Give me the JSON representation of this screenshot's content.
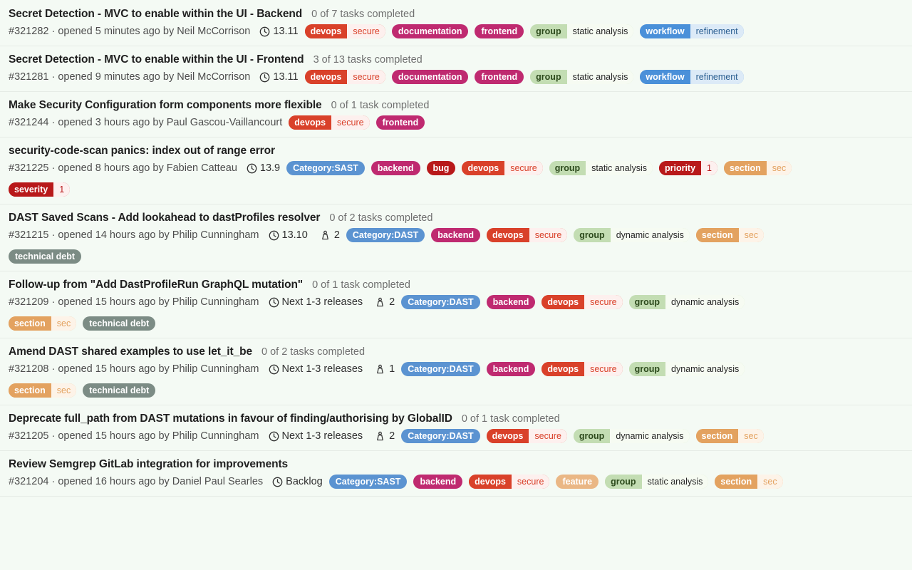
{
  "view": {
    "background_color": "#f4faf4",
    "separator_color": "#e6ece6",
    "icons": {
      "milestone": "clock-icon",
      "weight": "weight-icon"
    }
  },
  "label_styles": {
    "Category:SAST": {
      "type": "single",
      "bg": "#5b93d1",
      "fg": "#ffffff"
    },
    "Category:DAST": {
      "type": "single",
      "bg": "#5b93d1",
      "fg": "#ffffff"
    },
    "backend": {
      "type": "single",
      "bg": "#c02croak",
      "fg": "#ffffff"
    },
    "bug": {
      "type": "single",
      "bg": "#b8191a",
      "fg": "#ffffff"
    },
    "frontend": {
      "type": "single",
      "bg": "#bf2a70",
      "fg": "#ffffff"
    },
    "documentation": {
      "type": "single",
      "bg": "#bf2a70",
      "fg": "#ffffff"
    },
    "feature": {
      "type": "single",
      "bg": "#eab785",
      "fg": "#ffffff"
    },
    "technical debt": {
      "type": "single",
      "bg": "#7c8c85",
      "fg": "#ffffff"
    }
  },
  "issues": [
    {
      "title": "Secret Detection - MVC to enable within the UI - Backend",
      "task_status": "0 of 7 tasks completed",
      "reference": "#321282",
      "separator": "·",
      "opened": "opened 5 minutes ago by",
      "author": "Neil McCorrison",
      "milestone": "13.11",
      "weight": null,
      "labels": [
        {
          "key": "devops",
          "val": "secure",
          "key_bg": "#d9412a",
          "key_fg": "#ffffff",
          "val_bg": "#fdf0ee",
          "val_fg": "#d9412a"
        },
        {
          "key": "documentation",
          "val": null,
          "key_bg": "#bf2a70",
          "key_fg": "#ffffff"
        },
        {
          "key": "frontend",
          "val": null,
          "key_bg": "#bf2a70",
          "key_fg": "#ffffff"
        },
        {
          "key": "group",
          "val": "static analysis",
          "key_bg": "#c3ddb3",
          "key_fg": "#2c4a1c",
          "val_bg": "#f6fbf2",
          "val_fg": "#262626"
        },
        {
          "key": "workflow",
          "val": "refinement",
          "key_bg": "#4a90d9",
          "key_fg": "#ffffff",
          "val_bg": "#dceaf7",
          "val_fg": "#2b5f91"
        }
      ]
    },
    {
      "title": "Secret Detection - MVC to enable within the UI - Frontend",
      "task_status": "3 of 13 tasks completed",
      "reference": "#321281",
      "separator": "·",
      "opened": "opened 9 minutes ago by",
      "author": "Neil McCorrison",
      "milestone": "13.11",
      "weight": null,
      "labels": [
        {
          "key": "devops",
          "val": "secure",
          "key_bg": "#d9412a",
          "key_fg": "#ffffff",
          "val_bg": "#fdf0ee",
          "val_fg": "#d9412a"
        },
        {
          "key": "documentation",
          "val": null,
          "key_bg": "#bf2a70",
          "key_fg": "#ffffff"
        },
        {
          "key": "frontend",
          "val": null,
          "key_bg": "#bf2a70",
          "key_fg": "#ffffff"
        },
        {
          "key": "group",
          "val": "static analysis",
          "key_bg": "#c3ddb3",
          "key_fg": "#2c4a1c",
          "val_bg": "#f6fbf2",
          "val_fg": "#262626"
        },
        {
          "key": "workflow",
          "val": "refinement",
          "key_bg": "#4a90d9",
          "key_fg": "#ffffff",
          "val_bg": "#dceaf7",
          "val_fg": "#2b5f91"
        }
      ]
    },
    {
      "title": "Make Security Configuration form components more flexible",
      "task_status": "0 of 1 task completed",
      "reference": "#321244",
      "separator": "·",
      "opened": "opened 3 hours ago by",
      "author": "Paul Gascou-Vaillancourt",
      "milestone": null,
      "weight": null,
      "labels": [
        {
          "key": "devops",
          "val": "secure",
          "key_bg": "#d9412a",
          "key_fg": "#ffffff",
          "val_bg": "#fdf0ee",
          "val_fg": "#d9412a"
        },
        {
          "key": "frontend",
          "val": null,
          "key_bg": "#bf2a70",
          "key_fg": "#ffffff"
        }
      ]
    },
    {
      "title": "security-code-scan panics: index out of range error",
      "task_status": null,
      "reference": "#321225",
      "separator": "·",
      "opened": "opened 8 hours ago by",
      "author": "Fabien Catteau",
      "milestone": "13.9",
      "weight": null,
      "labels": [
        {
          "key": "Category:SAST",
          "val": null,
          "key_bg": "#5b93d1",
          "key_fg": "#ffffff"
        },
        {
          "key": "backend",
          "val": null,
          "key_bg": "#bf2a70",
          "key_fg": "#ffffff"
        },
        {
          "key": "bug",
          "val": null,
          "key_bg": "#b8191a",
          "key_fg": "#ffffff"
        },
        {
          "key": "devops",
          "val": "secure",
          "key_bg": "#d9412a",
          "key_fg": "#ffffff",
          "val_bg": "#fdf0ee",
          "val_fg": "#d9412a"
        },
        {
          "key": "group",
          "val": "static analysis",
          "key_bg": "#c3ddb3",
          "key_fg": "#2c4a1c",
          "val_bg": "#f6fbf2",
          "val_fg": "#262626"
        },
        {
          "key": "priority",
          "val": "1",
          "key_bg": "#b8191a",
          "key_fg": "#ffffff",
          "val_bg": "#fdf0ef",
          "val_fg": "#b8191a"
        },
        {
          "key": "section",
          "val": "sec",
          "key_bg": "#e3a260",
          "key_fg": "#ffffff",
          "val_bg": "#fdf3e8",
          "val_fg": "#e3a260"
        },
        {
          "key": "severity",
          "val": "1",
          "key_bg": "#b8191a",
          "key_fg": "#ffffff",
          "val_bg": "#fdf0ef",
          "val_fg": "#b8191a",
          "wrap_before": true
        }
      ]
    },
    {
      "title": "DAST Saved Scans - Add lookahead to dastProfiles resolver",
      "task_status": "0 of 2 tasks completed",
      "reference": "#321215",
      "separator": "·",
      "opened": "opened 14 hours ago by",
      "author": "Philip Cunningham",
      "milestone": "13.10",
      "weight": "2",
      "labels": [
        {
          "key": "Category:DAST",
          "val": null,
          "key_bg": "#5b93d1",
          "key_fg": "#ffffff"
        },
        {
          "key": "backend",
          "val": null,
          "key_bg": "#bf2a70",
          "key_fg": "#ffffff"
        },
        {
          "key": "devops",
          "val": "secure",
          "key_bg": "#d9412a",
          "key_fg": "#ffffff",
          "val_bg": "#fdf0ee",
          "val_fg": "#d9412a"
        },
        {
          "key": "group",
          "val": "dynamic analysis",
          "key_bg": "#c3ddb3",
          "key_fg": "#2c4a1c",
          "val_bg": "#f6fbf2",
          "val_fg": "#262626"
        },
        {
          "key": "section",
          "val": "sec",
          "key_bg": "#e3a260",
          "key_fg": "#ffffff",
          "val_bg": "#fdf3e8",
          "val_fg": "#e3a260"
        },
        {
          "key": "technical debt",
          "val": null,
          "key_bg": "#7c8c85",
          "key_fg": "#ffffff",
          "wrap_before": true
        }
      ]
    },
    {
      "title": "Follow-up from \"Add DastProfileRun GraphQL mutation\"",
      "task_status": "0 of 1 task completed",
      "reference": "#321209",
      "separator": "·",
      "opened": "opened 15 hours ago by",
      "author": "Philip Cunningham",
      "milestone": "Next 1-3 releases",
      "weight": "2",
      "labels": [
        {
          "key": "Category:DAST",
          "val": null,
          "key_bg": "#5b93d1",
          "key_fg": "#ffffff"
        },
        {
          "key": "backend",
          "val": null,
          "key_bg": "#bf2a70",
          "key_fg": "#ffffff"
        },
        {
          "key": "devops",
          "val": "secure",
          "key_bg": "#d9412a",
          "key_fg": "#ffffff",
          "val_bg": "#fdf0ee",
          "val_fg": "#d9412a"
        },
        {
          "key": "group",
          "val": "dynamic analysis",
          "key_bg": "#c3ddb3",
          "key_fg": "#2c4a1c",
          "val_bg": "#f6fbf2",
          "val_fg": "#262626"
        },
        {
          "key": "section",
          "val": "sec",
          "key_bg": "#e3a260",
          "key_fg": "#ffffff",
          "val_bg": "#fdf3e8",
          "val_fg": "#e3a260",
          "wrap_before": true
        },
        {
          "key": "technical debt",
          "val": null,
          "key_bg": "#7c8c85",
          "key_fg": "#ffffff"
        }
      ]
    },
    {
      "title": "Amend DAST shared examples to use let_it_be",
      "task_status": "0 of 2 tasks completed",
      "reference": "#321208",
      "separator": "·",
      "opened": "opened 15 hours ago by",
      "author": "Philip Cunningham",
      "milestone": "Next 1-3 releases",
      "weight": "1",
      "labels": [
        {
          "key": "Category:DAST",
          "val": null,
          "key_bg": "#5b93d1",
          "key_fg": "#ffffff"
        },
        {
          "key": "backend",
          "val": null,
          "key_bg": "#bf2a70",
          "key_fg": "#ffffff"
        },
        {
          "key": "devops",
          "val": "secure",
          "key_bg": "#d9412a",
          "key_fg": "#ffffff",
          "val_bg": "#fdf0ee",
          "val_fg": "#d9412a"
        },
        {
          "key": "group",
          "val": "dynamic analysis",
          "key_bg": "#c3ddb3",
          "key_fg": "#2c4a1c",
          "val_bg": "#f6fbf2",
          "val_fg": "#262626"
        },
        {
          "key": "section",
          "val": "sec",
          "key_bg": "#e3a260",
          "key_fg": "#ffffff",
          "val_bg": "#fdf3e8",
          "val_fg": "#e3a260",
          "wrap_before": true
        },
        {
          "key": "technical debt",
          "val": null,
          "key_bg": "#7c8c85",
          "key_fg": "#ffffff"
        }
      ]
    },
    {
      "title": "Deprecate full_path from DAST mutations in favour of finding/authorising by GlobalID",
      "task_status": "0 of 1 task completed",
      "reference": "#321205",
      "separator": "·",
      "opened": "opened 15 hours ago by",
      "author": "Philip Cunningham",
      "milestone": "Next 1-3 releases",
      "weight": "2",
      "labels": [
        {
          "key": "Category:DAST",
          "val": null,
          "key_bg": "#5b93d1",
          "key_fg": "#ffffff"
        },
        {
          "key": "devops",
          "val": "secure",
          "key_bg": "#d9412a",
          "key_fg": "#ffffff",
          "val_bg": "#fdf0ee",
          "val_fg": "#d9412a"
        },
        {
          "key": "group",
          "val": "dynamic analysis",
          "key_bg": "#c3ddb3",
          "key_fg": "#2c4a1c",
          "val_bg": "#f6fbf2",
          "val_fg": "#262626"
        },
        {
          "key": "section",
          "val": "sec",
          "key_bg": "#e3a260",
          "key_fg": "#ffffff",
          "val_bg": "#fdf3e8",
          "val_fg": "#e3a260"
        }
      ]
    },
    {
      "title": "Review Semgrep GitLab integration for improvements",
      "task_status": null,
      "reference": "#321204",
      "separator": "·",
      "opened": "opened 16 hours ago by",
      "author": "Daniel Paul Searles",
      "milestone": "Backlog",
      "weight": null,
      "labels": [
        {
          "key": "Category:SAST",
          "val": null,
          "key_bg": "#5b93d1",
          "key_fg": "#ffffff"
        },
        {
          "key": "backend",
          "val": null,
          "key_bg": "#bf2a70",
          "key_fg": "#ffffff"
        },
        {
          "key": "devops",
          "val": "secure",
          "key_bg": "#d9412a",
          "key_fg": "#ffffff",
          "val_bg": "#fdf0ee",
          "val_fg": "#d9412a"
        },
        {
          "key": "feature",
          "val": null,
          "key_bg": "#eab785",
          "key_fg": "#ffffff"
        },
        {
          "key": "group",
          "val": "static analysis",
          "key_bg": "#c3ddb3",
          "key_fg": "#2c4a1c",
          "val_bg": "#f6fbf2",
          "val_fg": "#262626"
        },
        {
          "key": "section",
          "val": "sec",
          "key_bg": "#e3a260",
          "key_fg": "#ffffff",
          "val_bg": "#fdf3e8",
          "val_fg": "#e3a260"
        }
      ]
    }
  ]
}
